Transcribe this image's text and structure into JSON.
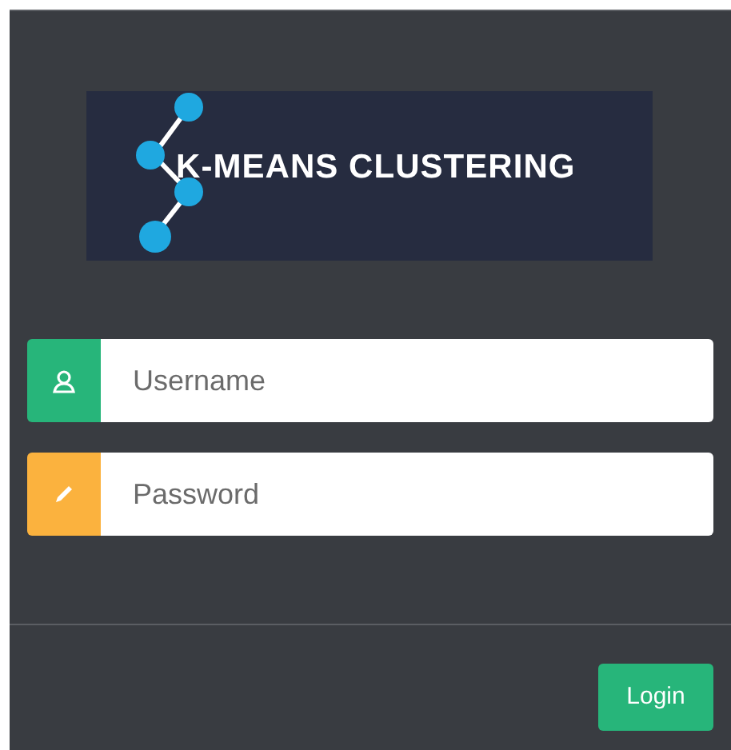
{
  "logo": {
    "title": "K-MEANS CLUSTERING"
  },
  "fields": [
    {
      "kind": "username",
      "placeholder": "Username",
      "color": "#27b57a"
    },
    {
      "kind": "password",
      "placeholder": "Password",
      "color": "#fbb23e"
    }
  ],
  "login_button": {
    "label": "Login"
  }
}
